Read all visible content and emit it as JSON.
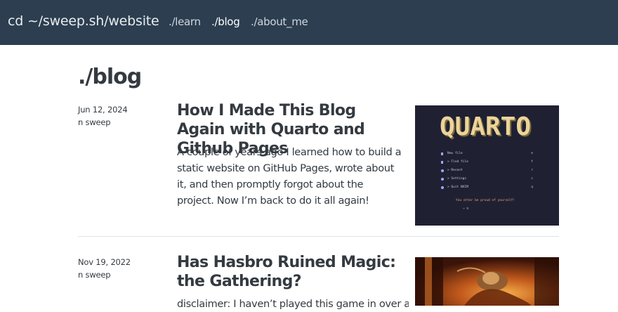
{
  "navbar": {
    "brand": "cd ~/sweep.sh/website",
    "links": [
      {
        "label": "./learn",
        "active": false
      },
      {
        "label": "./blog",
        "active": true
      },
      {
        "label": "./about_me",
        "active": false
      }
    ]
  },
  "page": {
    "title": "./blog"
  },
  "posts": [
    {
      "date": "Jun 12, 2024",
      "author": "n sweep",
      "title": "How I Made This Blog Again with Quarto and Github Pages",
      "description": "A couple of years ago I learned how to build a static website on GitHub Pages, wrote about it, and then promptly forgot about the project. Now I’m back to do it all again!",
      "thumbnail": {
        "logo_text": "QUARTO",
        "menu": [
          {
            "label": "New file",
            "key": "e"
          },
          {
            "label": "> Find file",
            "key": "f"
          },
          {
            "label": "> Recent",
            "key": "r"
          },
          {
            "label": "> Settings",
            "key": "c"
          },
          {
            "label": "> Quit NVIM",
            "key": "q"
          }
        ],
        "tagline": "You otter be proud of yourself!",
        "footer": "~ ↯"
      }
    },
    {
      "date": "Nov 19, 2022",
      "author": "n sweep",
      "title": "Has Hasbro Ruined Magic: the Gathering?",
      "description": "disclaimer: I haven’t played this game in over a",
      "thumbnail": {}
    }
  ],
  "colors": {
    "navbar_bg": "#2c3e50",
    "text": "#343a40",
    "divider": "#dee2e6",
    "quarto_bg": "#1f2133",
    "quarto_logo": "#ecd49a",
    "quarto_accent": "#e8a870"
  }
}
